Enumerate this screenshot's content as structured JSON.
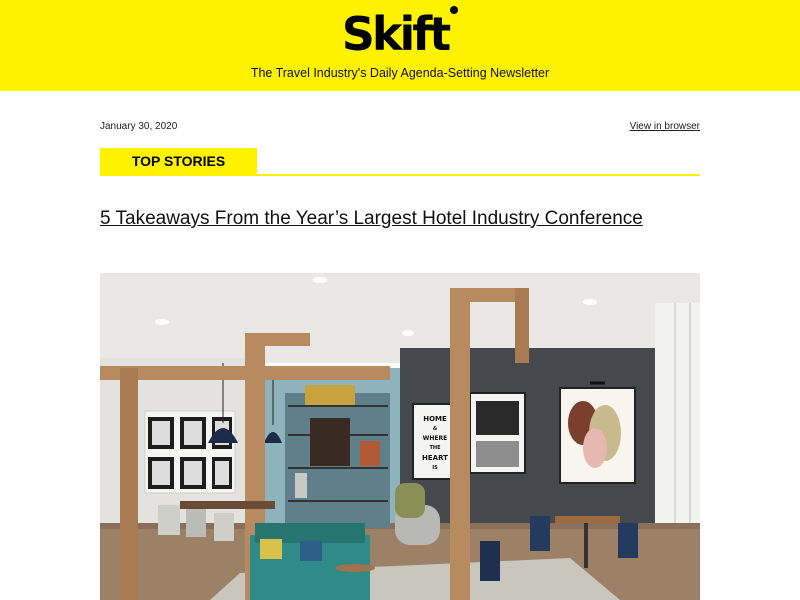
{
  "header": {
    "logo_text": "Skift",
    "tagline": "The Travel Industry's Daily Agenda-Setting Newsletter",
    "background": "#fff200"
  },
  "meta": {
    "date": "January 30, 2020",
    "view_in_browser": "View in browser"
  },
  "section": {
    "label": "TOP STORIES"
  },
  "article": {
    "headline": "5 Takeaways From the Year’s Largest Hotel Industry Conference"
  },
  "hero_image": {
    "poster_text": [
      "HOME",
      "&",
      "WHERE",
      "THE",
      "HEART",
      "IS"
    ]
  }
}
